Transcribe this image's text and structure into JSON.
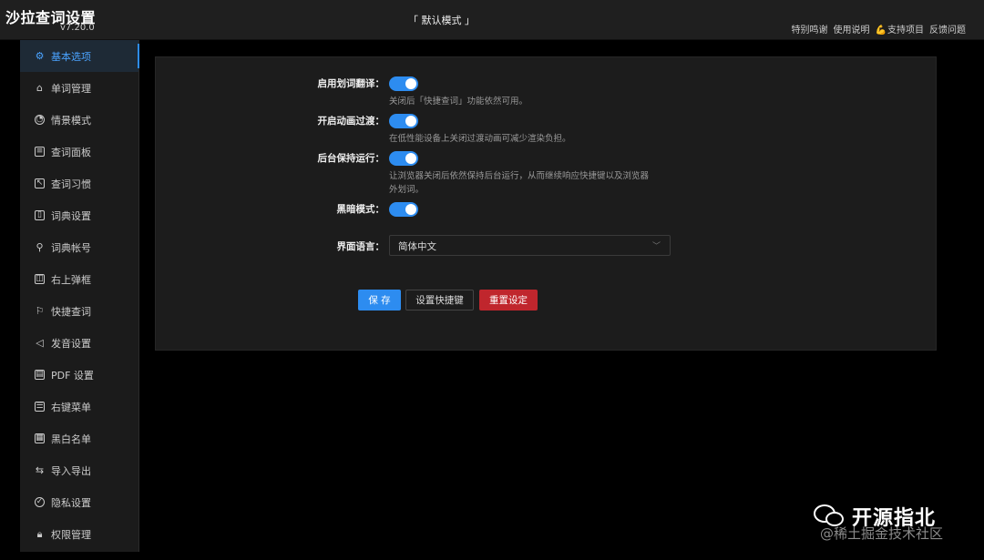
{
  "header": {
    "title": "沙拉查词设置",
    "version": "v7.20.0",
    "mode": "「 默认模式 」",
    "links": [
      {
        "label": "特别鸣谢",
        "icon": ""
      },
      {
        "label": "使用说明",
        "icon": ""
      },
      {
        "label": "支持项目",
        "icon": "muscle-icon"
      },
      {
        "label": "反馈问题",
        "icon": ""
      }
    ]
  },
  "sidebar": {
    "items": [
      {
        "label": "基本选项",
        "icon": "gear-icon",
        "active": true
      },
      {
        "label": "单词管理",
        "icon": "tag-icon"
      },
      {
        "label": "情景模式",
        "icon": "gauge-icon"
      },
      {
        "label": "查词面板",
        "icon": "panel-icon"
      },
      {
        "label": "查词习惯",
        "icon": "cursor-select-icon"
      },
      {
        "label": "词典设置",
        "icon": "book-icon"
      },
      {
        "label": "词典帐号",
        "icon": "key-icon"
      },
      {
        "label": "右上弹框",
        "icon": "window-icon"
      },
      {
        "label": "快捷查词",
        "icon": "flag-icon"
      },
      {
        "label": "发音设置",
        "icon": "speaker-icon"
      },
      {
        "label": "PDF 设置",
        "icon": "pdf-file-icon"
      },
      {
        "label": "右键菜单",
        "icon": "menu-doc-icon"
      },
      {
        "label": "黑白名单",
        "icon": "list-icon"
      },
      {
        "label": "导入导出",
        "icon": "swap-icon"
      },
      {
        "label": "隐私设置",
        "icon": "shield-icon"
      },
      {
        "label": "权限管理",
        "icon": "lock-icon"
      }
    ]
  },
  "settings": {
    "selection_translate": {
      "label": "启用划词翻译：",
      "on": true,
      "desc": "关闭后「快捷查词」功能依然可用。"
    },
    "animation": {
      "label": "开启动画过渡：",
      "on": true,
      "desc": "在低性能设备上关闭过渡动画可减少渲染负担。"
    },
    "background_run": {
      "label": "后台保持运行：",
      "on": true,
      "desc_line1": "让浏览器关闭后依然保持后台运行，从而继续响应快捷键以及浏览器",
      "desc_line2": "外划词。"
    },
    "dark_mode": {
      "label": "黑暗模式：",
      "on": true
    },
    "language": {
      "label": "界面语言：",
      "value": "简体中文"
    }
  },
  "buttons": {
    "save": "保 存",
    "shortcut": "设置快捷键",
    "reset": "重置设定"
  },
  "watermark": {
    "title": "开源指北",
    "sub": "@稀土掘金技术社区"
  },
  "colors": {
    "accent": "#2d8cf0",
    "danger": "#c0262d",
    "background": "#000000",
    "panel": "#1c1c1c"
  }
}
